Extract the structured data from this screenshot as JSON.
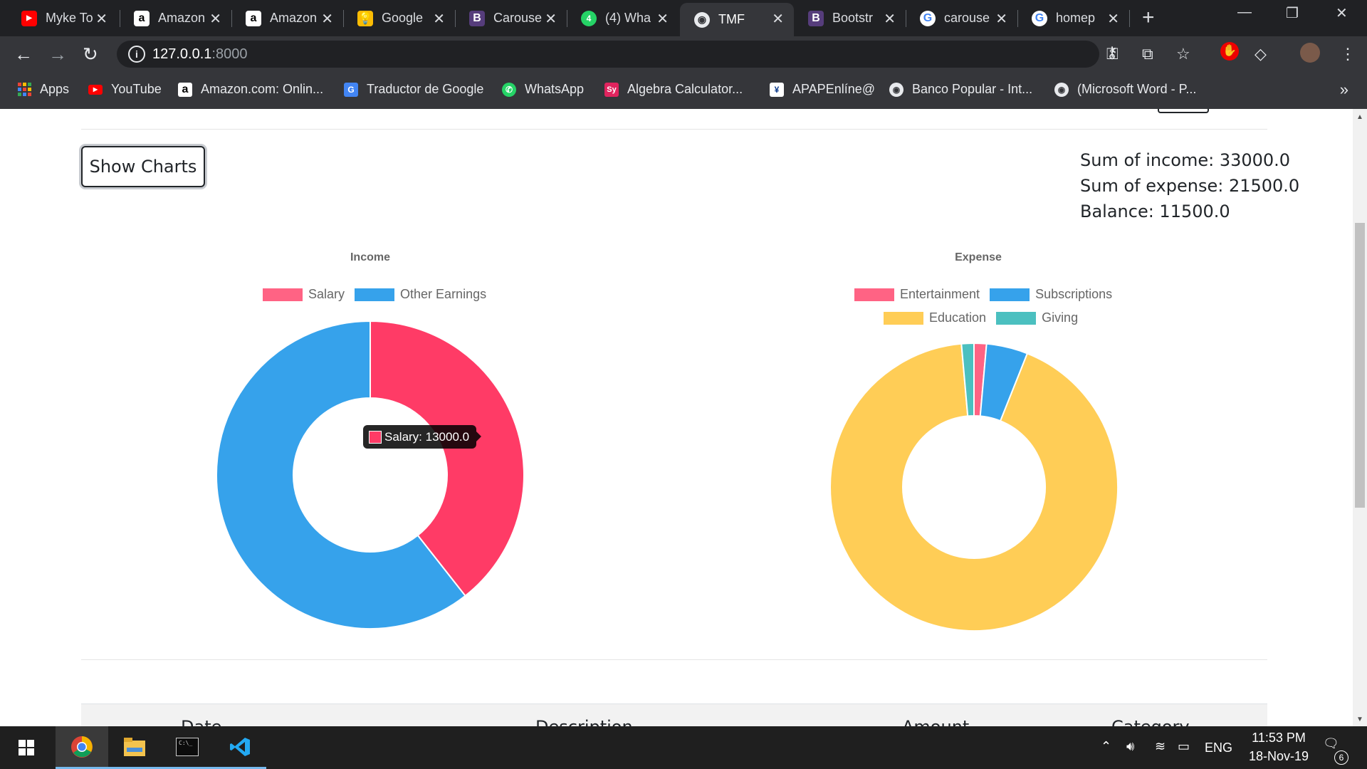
{
  "browser": {
    "tabs": [
      {
        "title": "Myke To",
        "icon": "youtube-icon",
        "color": "#ff0000"
      },
      {
        "title": "Amazon",
        "icon": "amazon-icon",
        "color": "#ffffff"
      },
      {
        "title": "Amazon",
        "icon": "amazon-icon",
        "color": "#ffffff"
      },
      {
        "title": "Google",
        "icon": "google-keep-icon",
        "color": "#fbbc04"
      },
      {
        "title": "Carouse",
        "icon": "bootstrap-icon",
        "color": "#563d7c"
      },
      {
        "title": "(4) Wha",
        "icon": "whatsapp-icon",
        "color": "#25d366"
      },
      {
        "title": "TMF",
        "icon": "globe-icon",
        "color": "#e8eaed",
        "active": true
      },
      {
        "title": "Bootstr",
        "icon": "bootstrap-icon",
        "color": "#563d7c"
      },
      {
        "title": "carouse",
        "icon": "google-icon",
        "color": "#ffffff"
      },
      {
        "title": "homep",
        "icon": "google-icon",
        "color": "#ffffff"
      }
    ],
    "url": {
      "host": "127.0.0.1",
      "port": ":8000"
    },
    "bookmarks": [
      {
        "label": "Apps",
        "icon": "apps-grid-icon"
      },
      {
        "label": "YouTube",
        "icon": "youtube-icon"
      },
      {
        "label": "Amazon.com: Onlin...",
        "icon": "amazon-icon"
      },
      {
        "label": "Traductor de Google",
        "icon": "google-translate-icon"
      },
      {
        "label": "WhatsApp",
        "icon": "whatsapp-icon"
      },
      {
        "label": "Algebra Calculator...",
        "icon": "symbolab-icon"
      },
      {
        "label": "APAPEnlíne@",
        "icon": "apap-icon"
      },
      {
        "label": "Banco Popular - Int...",
        "icon": "globe-icon"
      },
      {
        "label": "(Microsoft Word - P...",
        "icon": "globe-icon"
      }
    ]
  },
  "page": {
    "show_charts_label": "Show Charts",
    "summary": {
      "income": "Sum of income: 33000.0",
      "expense": "Sum of expense: 21500.0",
      "balance": "Balance: 11500.0"
    },
    "tooltip": {
      "text": "Salary: 13000.0",
      "color": "#ff3b66"
    },
    "table_headers": [
      "Date",
      "Description",
      "Amount",
      "Category"
    ]
  },
  "chart_data": [
    {
      "type": "pie",
      "title": "Income",
      "labels": [
        "Salary",
        "Other Earnings"
      ],
      "values": [
        13000,
        20000
      ],
      "colors": [
        "#ff3b66",
        "#36a2eb"
      ],
      "donut": true,
      "legend": "top"
    },
    {
      "type": "pie",
      "title": "Expense",
      "labels": [
        "Entertainment",
        "Subscriptions",
        "Education",
        "Giving"
      ],
      "values": [
        300,
        1000,
        19900,
        300
      ],
      "colors": [
        "#ff6384",
        "#36a2eb",
        "#ffcd56",
        "#4bc0c0"
      ],
      "donut": true,
      "legend": "top"
    }
  ],
  "taskbar": {
    "time": "11:53 PM",
    "date": "18-Nov-19",
    "language": "ENG",
    "notification_count": "6"
  }
}
